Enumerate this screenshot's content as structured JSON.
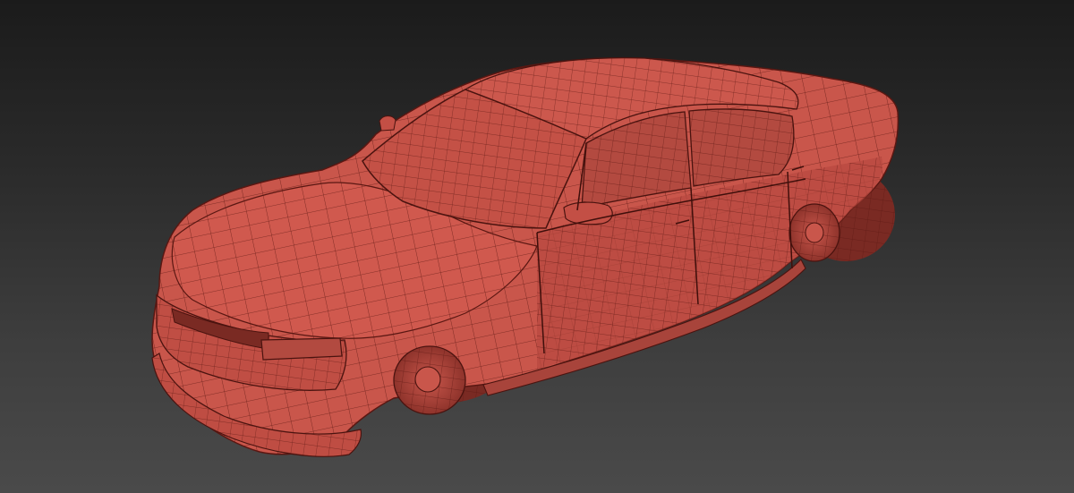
{
  "viewport": {
    "background_top": "#1b1b1b",
    "background_bottom": "#4a4a4a"
  },
  "model": {
    "surface_color": "#c9564b",
    "wire_color": "#5a1712",
    "shadow_color": "#8e332b",
    "highlight_color": "#d96b60"
  }
}
